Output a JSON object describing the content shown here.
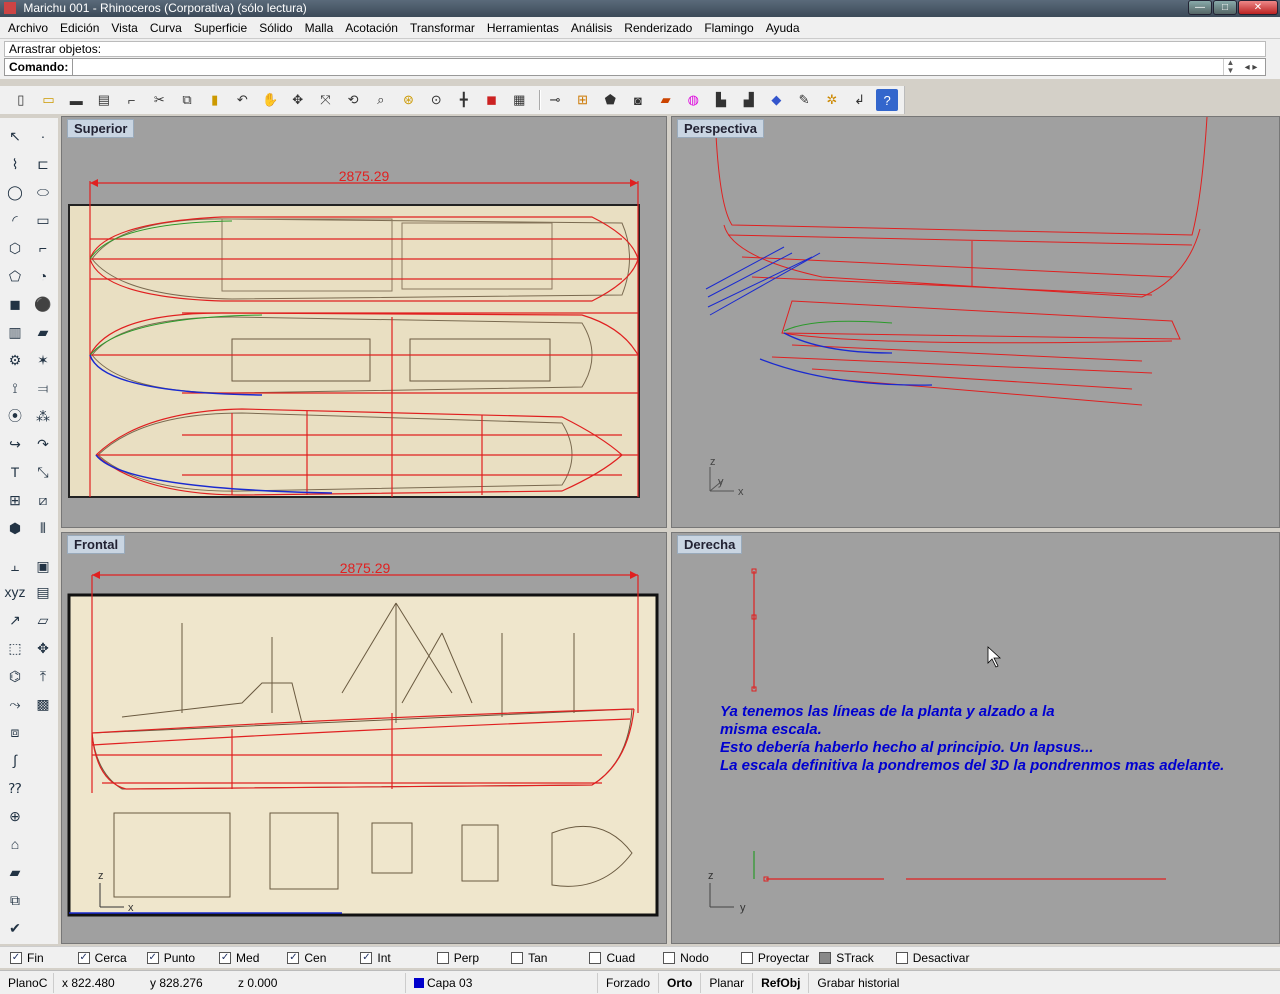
{
  "window": {
    "title": "Marichu 001 - Rhinoceros (Corporativa) (sólo lectura)",
    "min": "—",
    "max": "□",
    "close": "✕"
  },
  "menu": [
    "Archivo",
    "Edición",
    "Vista",
    "Curva",
    "Superficie",
    "Sólido",
    "Malla",
    "Acotación",
    "Transformar",
    "Herramientas",
    "Análisis",
    "Renderizado",
    "Flamingo",
    "Ayuda"
  ],
  "command": {
    "history": "Arrastrar objetos:",
    "label": "Comando:",
    "value": ""
  },
  "viewports": {
    "top": {
      "name": "Superior",
      "dimension": "2875.29"
    },
    "perspective": {
      "name": "Perspectiva"
    },
    "front": {
      "name": "Frontal",
      "dimension": "2875.29"
    },
    "right": {
      "name": "Derecha"
    }
  },
  "note": "Ya tenemos las líneas de la planta y alzado a la\nmisma escala.\nEsto debería haberlo hecho al principio. Un lapsus...\nLa escala definitiva la pondremos del 3D la pondrenmos mas adelante.",
  "axes": {
    "x": "x",
    "y": "y",
    "z": "z"
  },
  "osnaps": [
    {
      "label": "Fin",
      "checked": true
    },
    {
      "label": "Cerca",
      "checked": true
    },
    {
      "label": "Punto",
      "checked": true
    },
    {
      "label": "Med",
      "checked": true
    },
    {
      "label": "Cen",
      "checked": true
    },
    {
      "label": "Int",
      "checked": true
    },
    {
      "label": "Perp",
      "checked": false
    },
    {
      "label": "Tan",
      "checked": false
    },
    {
      "label": "Cuad",
      "checked": false
    },
    {
      "label": "Nodo",
      "checked": false
    },
    {
      "label": "Proyectar",
      "checked": false
    },
    {
      "label": "STrack",
      "checked": false
    },
    {
      "label": "Desactivar",
      "checked": false
    }
  ],
  "status": {
    "plane": "PlanoC",
    "x": "x 822.480",
    "y": "y 828.276",
    "z": "z 0.000",
    "layer": "Capa 03",
    "snap": "Forzado",
    "ortho": "Orto",
    "planar": "Planar",
    "refobj": "RefObj",
    "history": "Grabar historial"
  },
  "colors": {
    "curve_red": "#e02020",
    "curve_blue": "#1a2ad0",
    "curve_green": "#2a9a2a",
    "viewport_bg": "#a0a0a0",
    "note_blue": "#0000d0"
  }
}
